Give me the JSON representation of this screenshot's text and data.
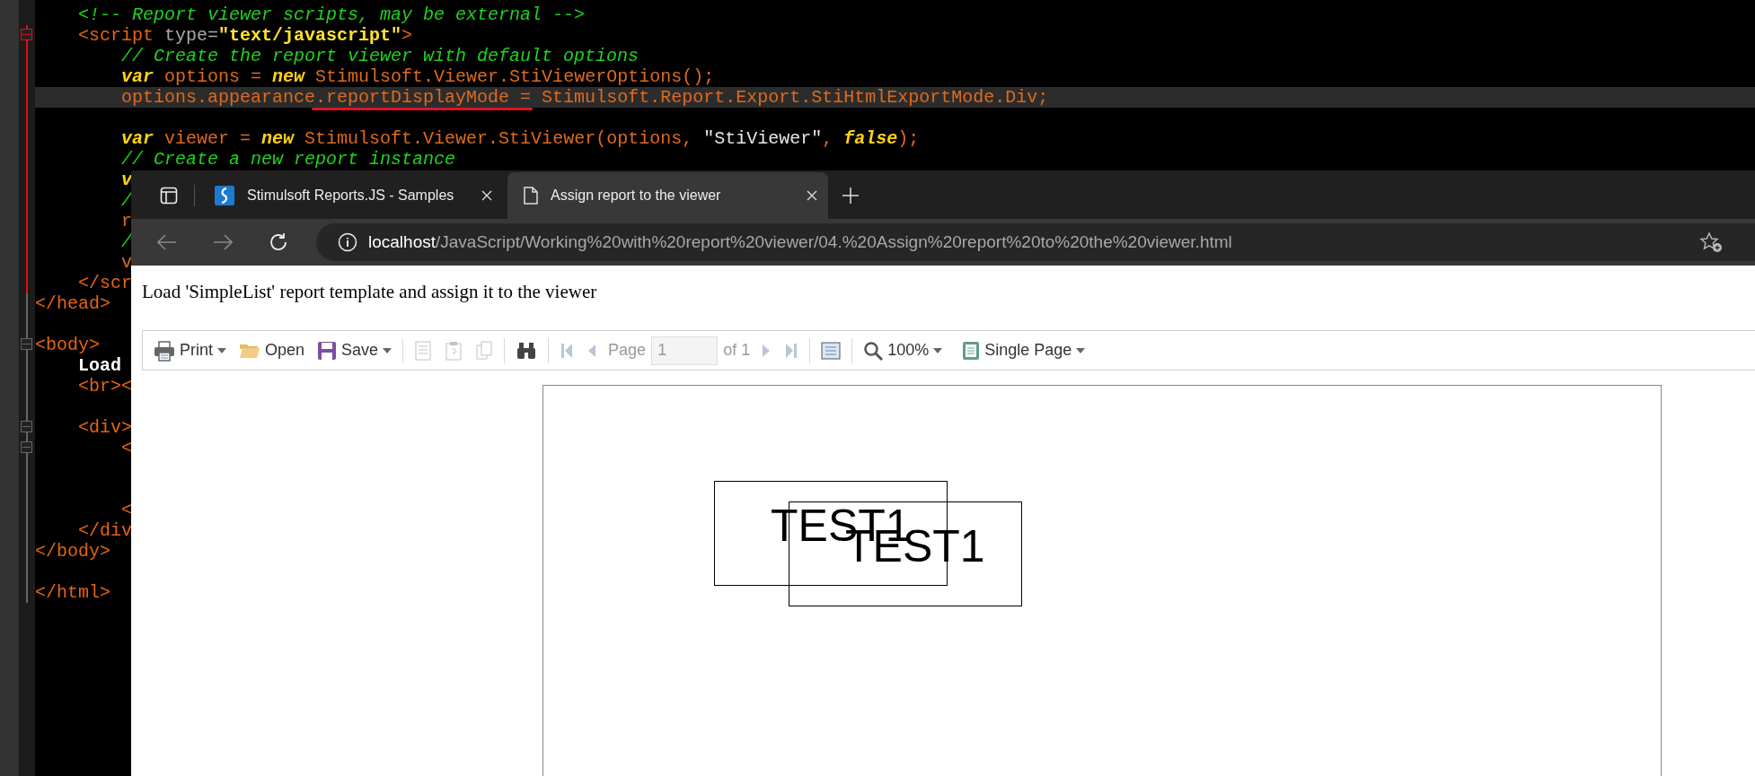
{
  "editor": {
    "lines": [
      {
        "current": false,
        "tokens": [
          {
            "text": "    <!-- Report viewer scripts, may be external -->",
            "kind": "comment"
          }
        ]
      },
      {
        "in_block": true,
        "fold": true,
        "current": false,
        "tokens": [
          {
            "text": "    <script ",
            "kind": "tag"
          },
          {
            "text": "type=",
            "kind": "attr"
          },
          {
            "text": "\"text/javascript\"",
            "kind": "string"
          },
          {
            "text": ">",
            "kind": "tag"
          }
        ]
      },
      {
        "in_block": true,
        "fold": false,
        "current": false,
        "tokens": [
          {
            "text": "        // Create the report viewer with default options",
            "kind": "comment"
          }
        ]
      },
      {
        "in_block": true,
        "fold": false,
        "current": false,
        "tokens": [
          {
            "text": "        var",
            "kind": "keyword"
          },
          {
            "text": " options = ",
            "kind": "ident"
          },
          {
            "text": "new",
            "kind": "keyword"
          },
          {
            "text": " Stimulsoft.Viewer.StiViewerOptions();",
            "kind": "ident"
          }
        ]
      },
      {
        "in_block": true,
        "fold": false,
        "current": true,
        "tokens": [
          {
            "text": "        options.appearance",
            "kind": "ident"
          },
          {
            "text": ".reportDisplayMode",
            "kind": "ident",
            "marked": true
          },
          {
            "text": " = Stimulsoft.Report.Export.StiHtmlExportMode.Div;",
            "kind": "ident"
          }
        ]
      },
      {
        "in_block": true,
        "fold": false,
        "current": false
      },
      {
        "in_block": true,
        "fold": false,
        "current": false,
        "tokens": [
          {
            "text": "        var",
            "kind": "keyword"
          },
          {
            "text": " viewer = ",
            "kind": "ident"
          },
          {
            "text": "new",
            "kind": "keyword"
          },
          {
            "text": " Stimulsoft.Viewer.StiViewer(options, ",
            "kind": "ident"
          },
          {
            "text": "\"StiViewer\"",
            "kind": "literal"
          },
          {
            "text": ", ",
            "kind": "ident"
          },
          {
            "text": "false",
            "kind": "keyword"
          },
          {
            "text": ");",
            "kind": "ident"
          }
        ]
      },
      {
        "in_block": true,
        "fold": false,
        "current": false,
        "tokens": [
          {
            "text": "        // Create a new report instance",
            "kind": "comment"
          }
        ]
      },
      {
        "in_block": true,
        "fold": false,
        "current": false,
        "tokens": [
          {
            "text": "        v",
            "kind": "keyword"
          }
        ]
      },
      {
        "in_block": true,
        "fold": false,
        "current": false,
        "tokens": [
          {
            "text": "        /",
            "kind": "comment"
          }
        ]
      },
      {
        "in_block": true,
        "fold": false,
        "current": false,
        "tokens": [
          {
            "text": "        r",
            "kind": "ident"
          }
        ]
      },
      {
        "in_block": true,
        "fold": false,
        "current": false,
        "tokens": [
          {
            "text": "        /",
            "kind": "comment"
          }
        ]
      },
      {
        "in_block": true,
        "fold": false,
        "current": false,
        "tokens": [
          {
            "text": "        v",
            "kind": "ident"
          }
        ]
      },
      {
        "in_block": true,
        "fold": false,
        "current": false,
        "tokens": [
          {
            "text": "    </scr",
            "kind": "tag"
          }
        ]
      },
      {
        "in_block": false,
        "fold": false,
        "current": false,
        "tokens": [
          {
            "text": "</head>",
            "kind": "tag"
          }
        ]
      },
      {
        "in_block": false,
        "fold": false,
        "current": false
      },
      {
        "in_block": false,
        "fold": true,
        "current": false,
        "tokens": [
          {
            "text": "<body>",
            "kind": "tag"
          }
        ]
      },
      {
        "in_block": false,
        "fold": false,
        "current": false,
        "tokens": [
          {
            "text": "    Load",
            "kind": "text"
          }
        ]
      },
      {
        "in_block": false,
        "fold": false,
        "current": false,
        "tokens": [
          {
            "text": "    <br><",
            "kind": "tag"
          }
        ]
      },
      {
        "in_block": false,
        "fold": false,
        "current": false
      },
      {
        "in_block": false,
        "fold": true,
        "current": false,
        "tokens": [
          {
            "text": "    <div>",
            "kind": "tag"
          }
        ]
      },
      {
        "in_block": false,
        "fold": true,
        "current": false,
        "tokens": [
          {
            "text": "        <",
            "kind": "tag"
          }
        ]
      },
      {
        "in_block": false,
        "fold": false,
        "current": false
      },
      {
        "in_block": false,
        "fold": false,
        "current": false
      },
      {
        "in_block": false,
        "fold": false,
        "current": false,
        "tokens": [
          {
            "text": "        <",
            "kind": "tag"
          }
        ]
      },
      {
        "in_block": false,
        "fold": false,
        "current": false,
        "tokens": [
          {
            "text": "    </div",
            "kind": "tag"
          }
        ]
      },
      {
        "in_block": false,
        "fold": false,
        "current": false,
        "tokens": [
          {
            "text": "</body>",
            "kind": "tag"
          }
        ]
      },
      {
        "in_block": false,
        "fold": false,
        "current": false
      },
      {
        "in_block": false,
        "fold": false,
        "current": false,
        "tokens": [
          {
            "text": "</html>",
            "kind": "tag"
          }
        ]
      }
    ]
  },
  "browser": {
    "tabs": [
      {
        "title": "Stimulsoft Reports.JS - Samples",
        "selected": false
      },
      {
        "title": "Assign report to the viewer",
        "selected": true
      }
    ],
    "address": {
      "host": "localhost",
      "path": "/JavaScript/Working%20with%20report%20viewer/04.%20Assign%20report%20to%20the%20viewer.html"
    },
    "page": {
      "intro": "Load 'SimpleList' report template and assign it to the viewer",
      "toolbar": {
        "print": {
          "label": "Print",
          "dropdown": true
        },
        "open": {
          "label": "Open"
        },
        "save": {
          "label": "Save",
          "dropdown": true
        },
        "tools": [
          {
            "disabled": true
          },
          {
            "disabled": true
          },
          {
            "disabled": true
          }
        ],
        "find": {
          "disabled": false
        },
        "first": {
          "disabled": true
        },
        "prev": {
          "disabled": true
        },
        "page": {
          "label": "Page",
          "value": "1",
          "suffix": "of 1"
        },
        "next": {
          "disabled": true
        },
        "last": {
          "disabled": true
        },
        "view": {
          "disabled": false
        },
        "zoom": {
          "label": "100%",
          "dropdown": true
        },
        "mode": {
          "label": "Single Page",
          "dropdown": true
        }
      },
      "report": {
        "fields": [
          {
            "text": "TEST1"
          },
          {
            "text": "TEST1"
          }
        ]
      }
    }
  }
}
